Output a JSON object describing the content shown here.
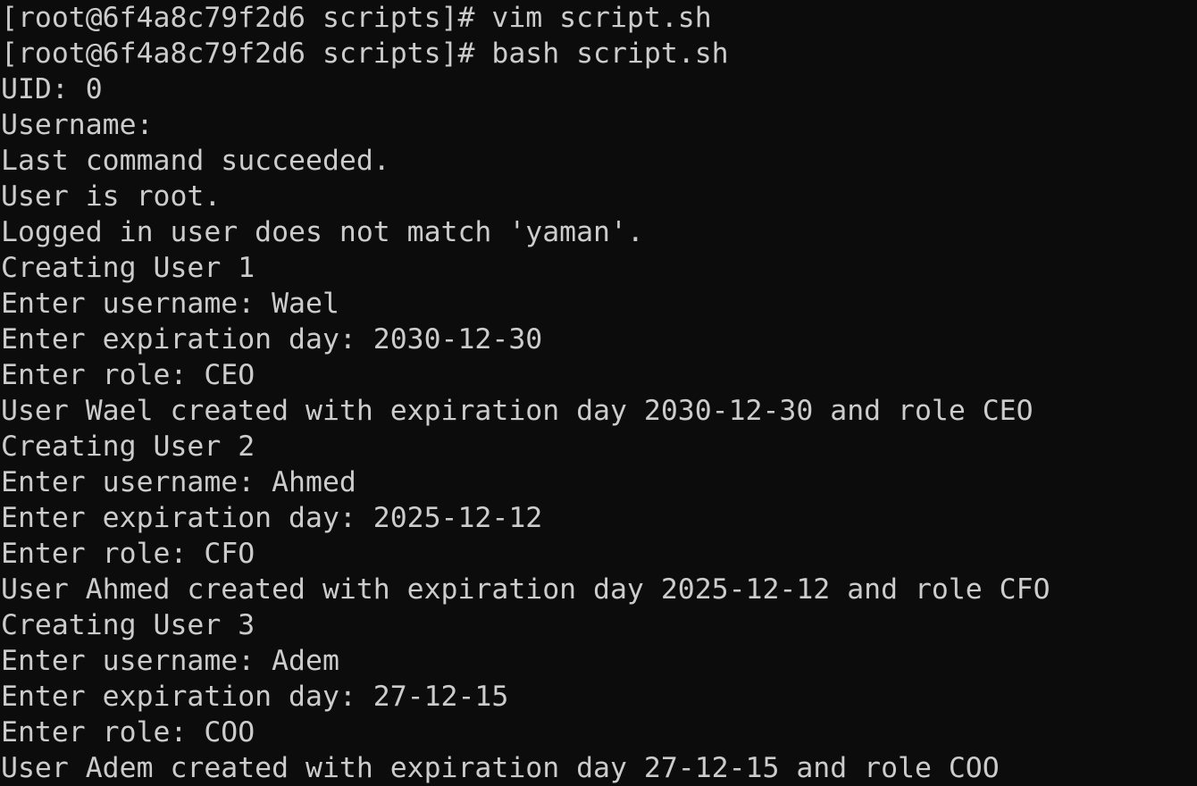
{
  "terminal": {
    "lines": [
      "[root@6f4a8c79f2d6 scripts]# vim script.sh",
      "[root@6f4a8c79f2d6 scripts]# bash script.sh",
      "UID: 0",
      "Username:",
      "Last command succeeded.",
      "User is root.",
      "Logged in user does not match 'yaman'.",
      "Creating User 1",
      "Enter username: Wael",
      "Enter expiration day: 2030-12-30",
      "Enter role: CEO",
      "User Wael created with expiration day 2030-12-30 and role CEO",
      "Creating User 2",
      "Enter username: Ahmed",
      "Enter expiration day: 2025-12-12",
      "Enter role: CFO",
      "User Ahmed created with expiration day 2025-12-12 and role CFO",
      "Creating User 3",
      "Enter username: Adem",
      "Enter expiration day: 27-12-15",
      "Enter role: COO",
      "User Adem created with expiration day 27-12-15 and role COO"
    ]
  }
}
